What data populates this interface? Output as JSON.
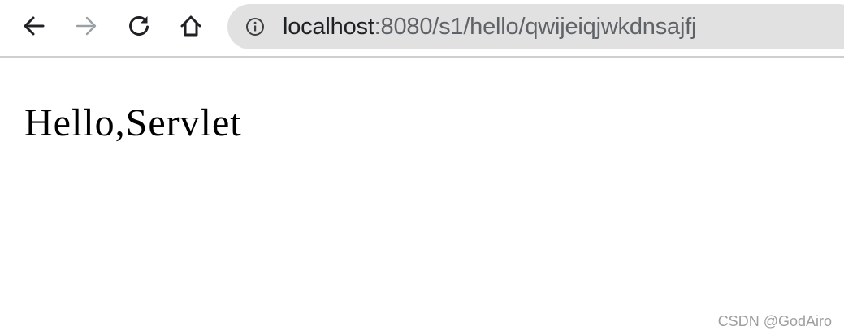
{
  "toolbar": {
    "back_icon": "arrow-left-icon",
    "forward_icon": "arrow-right-icon",
    "reload_icon": "reload-icon",
    "home_icon": "home-icon",
    "info_icon": "info-circle-icon",
    "forward_disabled": true
  },
  "address_bar": {
    "host": "localhost",
    "path": ":8080/s1/hello/qwijeiqjwkdnsajfj"
  },
  "page": {
    "content": "Hello,Servlet"
  },
  "watermark": {
    "text": "CSDN @GodAiro"
  },
  "colors": {
    "omnibox_background": "#e1e1e1",
    "toolbar_divider": "#cfcfcf",
    "icon_active": "#202124",
    "icon_disabled": "#9aa0a6",
    "watermark": "#9e9e9e"
  }
}
